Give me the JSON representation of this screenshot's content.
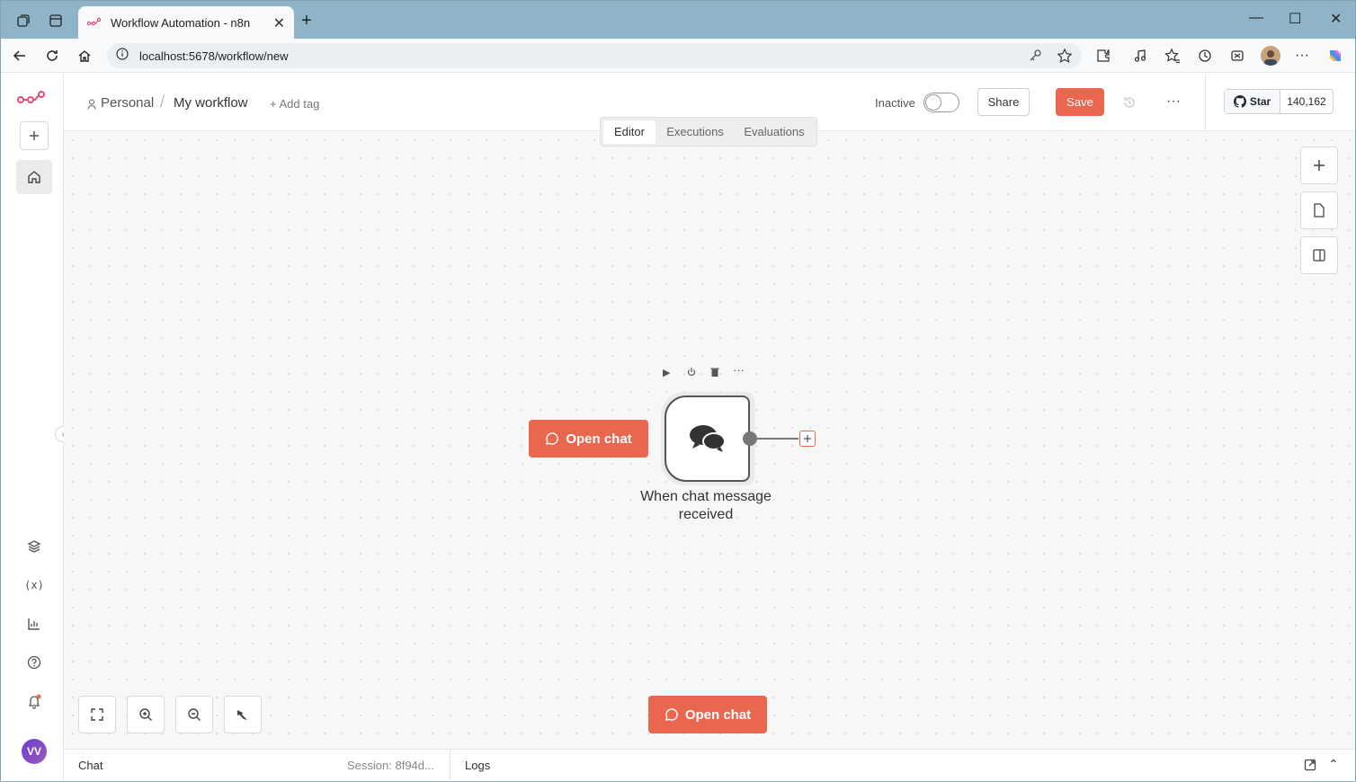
{
  "browser": {
    "tab_title": "Workflow Automation - n8n",
    "url": "localhost:5678/workflow/new"
  },
  "header": {
    "project": "Personal",
    "workflow_name": "My workflow",
    "add_tag": "+ Add tag",
    "status_label": "Inactive",
    "share_label": "Share",
    "save_label": "Save",
    "star_label": "Star",
    "star_count": "140,162"
  },
  "tabs": [
    {
      "label": "Editor",
      "active": true
    },
    {
      "label": "Executions",
      "active": false
    },
    {
      "label": "Evaluations",
      "active": false
    }
  ],
  "node": {
    "label": "When chat message received",
    "open_chat_label": "Open chat"
  },
  "canvas": {
    "open_chat_button": "Open chat"
  },
  "bottom": {
    "chat_label": "Chat",
    "session_label": "Session: 8f94d...",
    "logs_label": "Logs"
  },
  "user": {
    "initials": "VV"
  },
  "colors": {
    "accent": "#e9664f",
    "brand": "#ea4b71"
  }
}
